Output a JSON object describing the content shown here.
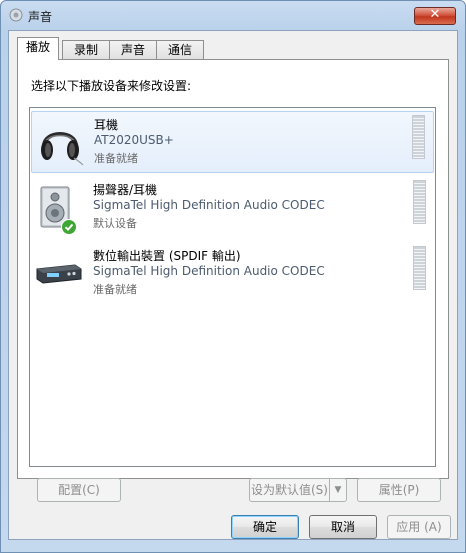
{
  "window": {
    "title": "声音",
    "close_icon": "close-icon"
  },
  "tabs": [
    {
      "label": "播放",
      "active": true
    },
    {
      "label": "录制",
      "active": false
    },
    {
      "label": "声音",
      "active": false
    },
    {
      "label": "通信",
      "active": false
    }
  ],
  "panel": {
    "instruction": "选择以下播放设备来修改设置:"
  },
  "devices": [
    {
      "name": "耳機",
      "detail": "AT2020USB+",
      "status": "准备就绪",
      "icon": "headphones-icon",
      "selected": true
    },
    {
      "name": "揚聲器/耳機",
      "detail": "SigmaTel High Definition Audio CODEC",
      "status": "默认设备",
      "icon": "speaker-icon",
      "default_badge": "check-icon",
      "selected": false
    },
    {
      "name": "數位輸出裝置 (SPDIF 輸出)",
      "detail": "SigmaTel High Definition Audio CODEC",
      "status": "准备就绪",
      "icon": "digital-output-icon",
      "selected": false
    }
  ],
  "buttons": {
    "configure": "配置(C)",
    "set_default": "设为默认值(S)",
    "properties": "属性(P)",
    "ok": "确定",
    "cancel": "取消",
    "apply": "应用 (A)"
  },
  "colors": {
    "selection": "#e4eefb",
    "close_button": "#c2361f",
    "default_badge": "#3fa535"
  }
}
